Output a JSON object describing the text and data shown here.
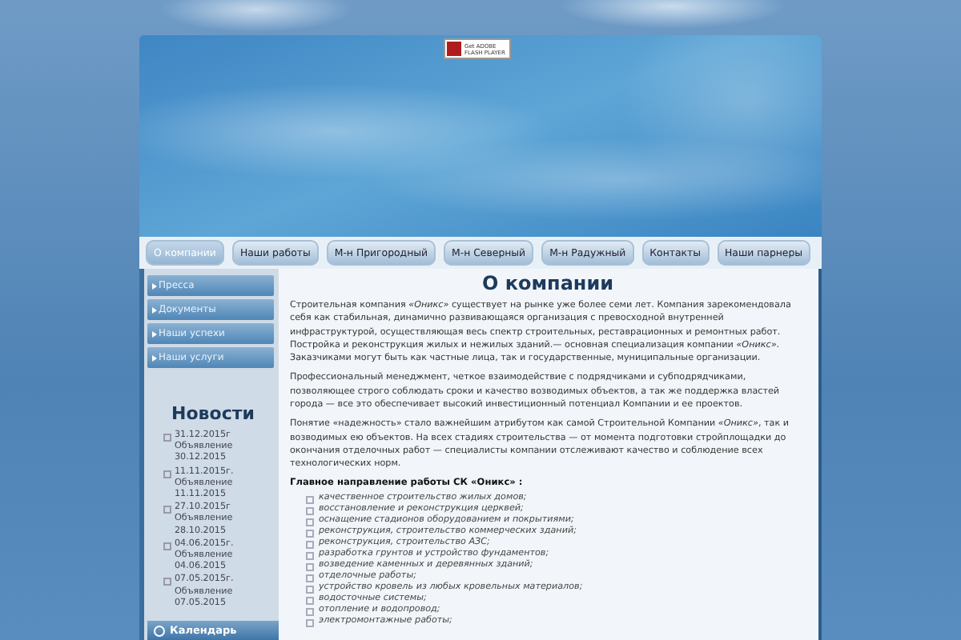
{
  "flash_badge": {
    "line_1": "Get ADOBE",
    "line_2": "FLASH PLAYER"
  },
  "nav": [
    {
      "label": "О компании",
      "selected": true
    },
    {
      "label": "Наши работы",
      "selected": false
    },
    {
      "label": "М-н Пригородный",
      "selected": false
    },
    {
      "label": "М-н Северный",
      "selected": false
    },
    {
      "label": "М-н Радужный",
      "selected": false
    },
    {
      "label": "Контакты",
      "selected": false
    },
    {
      "label": "Наши парнеры",
      "selected": false
    }
  ],
  "sidebar": {
    "menu": [
      "Пресса",
      "Документы",
      "Наши успехи",
      "Наши услуги"
    ],
    "news_title": "Новости",
    "news": [
      {
        "date": "31.12.2015г",
        "title": "Объявление",
        "posted": "30.12.2015"
      },
      {
        "date": "11.11.2015г.",
        "title": "Объявление",
        "posted": "11.11.2015"
      },
      {
        "date": "27.10.2015г",
        "title": "Объявление",
        "posted": "28.10.2015"
      },
      {
        "date": "04.06.2015г.",
        "title": "Объявление",
        "posted": "04.06.2015"
      },
      {
        "date": "07.05.2015г.",
        "title": "Объявление",
        "posted": "07.05.2015"
      }
    ],
    "calendar_label": "Календарь"
  },
  "content": {
    "title": "О компании",
    "paragraphs": [
      "Строительная компания *«Оникс»* существует на рынке уже более семи лет. Компания зарекомендовала себя как стабильная, динамично развивающаяся организация с превосходной внутренней инфраструктурой, осуществляющая весь спектр строительных, реставрационных и ремонтных работ. Постройка и реконструкция жилых и нежилых зданий.— основная специализация компании *«Оникс»*. Заказчиками могут быть как частные лица, так и государственные, муниципальные организации.",
      "Профессиональный менеджмент, четкое взаимодействие с подрядчиками и субподрядчиками, позволяющее строго соблюдать сроки и качество возводимых объектов, а так же поддержка властей города — все это обеспечивает высокий инвестиционный потенциал Компании и ее проектов.",
      "Понятие «надежность» стало важнейшим атрибутом как самой Строительной Компании *«Оникс»*, так и возводимых ею объектов. На всех стадиях строительства — от момента подготовки стройплощадки до окончания отделочных работ — специалисты компании отслеживают качество и соблюдение всех технологических норм."
    ],
    "list_heading": "Главное направление работы СК «Оникс» :",
    "list": [
      "качественное строительство жилых домов;",
      "восстановление и реконструкция церквей;",
      "оснащение стадионов оборудованием и покрытиями;",
      "реконструкция, строительство коммерческих зданий;",
      "реконструкция, строительство АЗС;",
      "разработка грунтов и устройство фундаментов;",
      "возведение каменных и деревянных зданий;",
      "отделочные работы;",
      "устройство кровель из любых кровельных материалов;",
      "водосточные системы;",
      "отопление и водопровод;",
      "электромонтажные работы;"
    ]
  }
}
